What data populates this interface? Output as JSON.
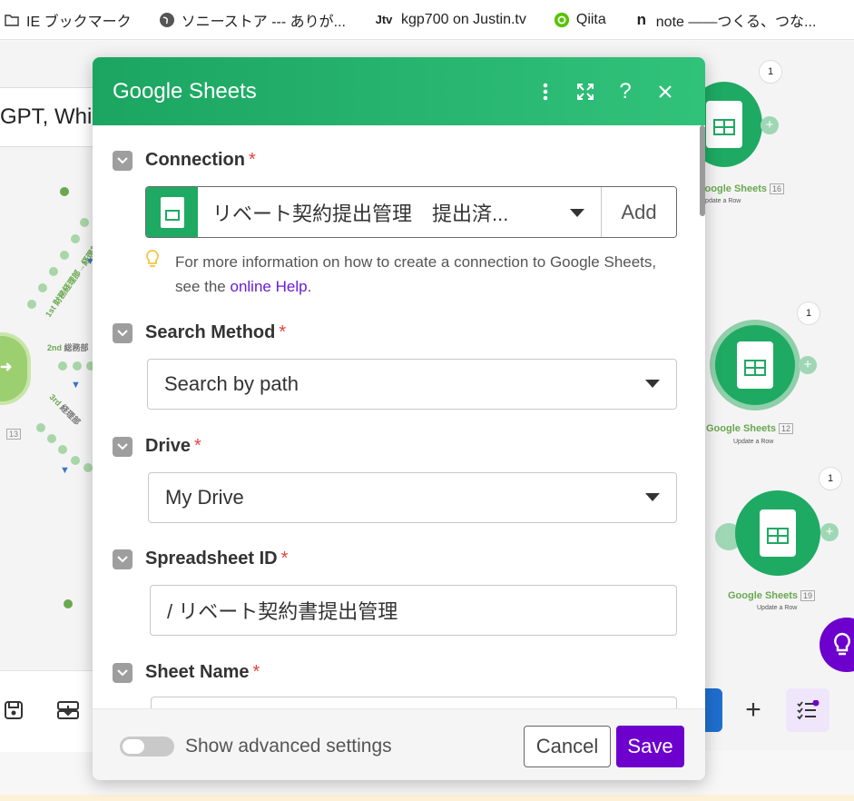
{
  "bookmarks": [
    {
      "label": "IE ブックマーク",
      "icon": "folder-icon"
    },
    {
      "label": "ソニーストア --- ありが...",
      "icon": "globe-icon"
    },
    {
      "label": "kgp700 on Justin.tv",
      "icon": "jtv-icon"
    },
    {
      "label": "Qiita",
      "icon": "qiita-icon"
    },
    {
      "label": "note ――つくる、つな...",
      "icon": "note-icon"
    }
  ],
  "scenario_title": "GPT, Whis",
  "routes": [
    {
      "label": "1st",
      "text": "財務経理部→経理部(担当)"
    },
    {
      "label": "2nd",
      "text": "総務部"
    },
    {
      "label": "3rd",
      "text": "経理部"
    }
  ],
  "left_badge_count": "13",
  "modules": [
    {
      "name": "Google Sheets",
      "count": "16",
      "action": "Update a Row",
      "bubble": "1"
    },
    {
      "name": "Google Sheets",
      "count": "12",
      "action": "Update a Row",
      "bubble": "1"
    },
    {
      "name": "Google Sheets",
      "count": "19",
      "action": "Update a Row",
      "bubble": "1"
    }
  ],
  "modal": {
    "title": "Google Sheets",
    "connection": {
      "label": "Connection",
      "required": "*",
      "value": "リベート契約提出管理　提出済...",
      "add_label": "Add",
      "hint_before": "For more information on how to create a connection to Google Sheets, see the",
      "hint_link": "online Help",
      "hint_after": "."
    },
    "search_method": {
      "label": "Search Method",
      "required": "*",
      "value": "Search by path"
    },
    "drive": {
      "label": "Drive",
      "required": "*",
      "value": "My Drive"
    },
    "spreadsheet_id": {
      "label": "Spreadsheet ID",
      "required": "*",
      "value": "/ リベート契約書提出管理"
    },
    "sheet_name": {
      "label": "Sheet Name",
      "required": "*",
      "value": ""
    },
    "footer": {
      "advanced_label": "Show advanced settings",
      "advanced_on": false,
      "cancel_label": "Cancel",
      "save_label": "Save"
    }
  },
  "colors": {
    "header_green": "#1ba561",
    "sheets_green": "#1eaa63",
    "save_purple": "#6d00cc",
    "required_red": "#e2453d",
    "link_purple": "#6a1bd6"
  }
}
